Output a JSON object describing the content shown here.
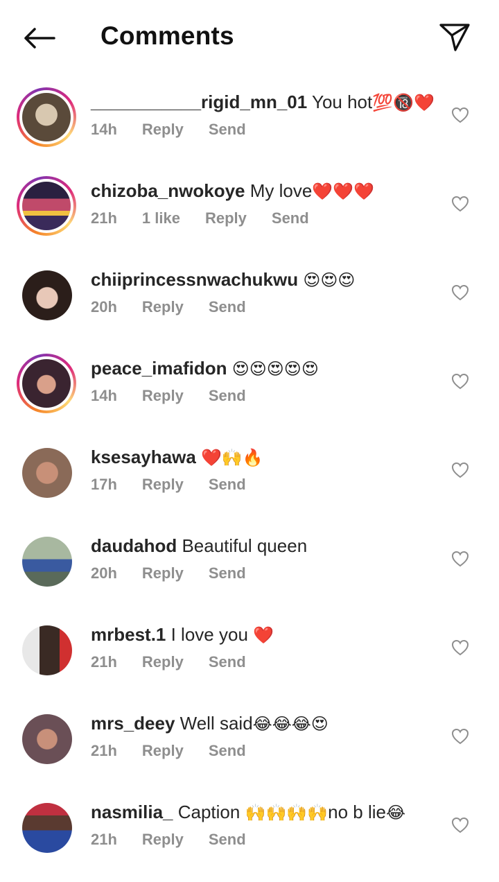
{
  "header": {
    "title": "Comments",
    "back_icon": "arrow-left-icon",
    "share_icon": "paper-plane-icon"
  },
  "comments": [
    {
      "username": "___________rigid_mn_01",
      "text": " You hot",
      "emoji": "💯🔞❤️",
      "time": "14h",
      "likes": "",
      "reply": "Reply",
      "send": "Send",
      "story": true,
      "avatar_bg": "#5a4a3a"
    },
    {
      "username": "chizoba_nwokoye",
      "text": " My love",
      "emoji": "❤️❤️❤️",
      "time": "21h",
      "likes": "1 like",
      "reply": "Reply",
      "send": "Send",
      "story": true,
      "avatar_bg": "#7a3b8a"
    },
    {
      "username": "chiiprincessnwachukwu",
      "text": " ",
      "emoji": "😍😍😍",
      "time": "20h",
      "likes": "",
      "reply": "Reply",
      "send": "Send",
      "story": false,
      "avatar_bg": "#2b1e1a"
    },
    {
      "username": "peace_imafidon",
      "text": " ",
      "emoji": "😍😍😍😍😍",
      "time": "14h",
      "likes": "",
      "reply": "Reply",
      "send": "Send",
      "story": true,
      "avatar_bg": "#3a2430"
    },
    {
      "username": "ksesayhawa",
      "text": " ",
      "emoji": "❤️🙌🔥",
      "time": "17h",
      "likes": "",
      "reply": "Reply",
      "send": "Send",
      "story": false,
      "avatar_bg": "#8a6a58"
    },
    {
      "username": "daudahod",
      "text": " Beautiful queen",
      "emoji": "",
      "time": "20h",
      "likes": "",
      "reply": "Reply",
      "send": "Send",
      "story": false,
      "avatar_bg": "#6b7a6a"
    },
    {
      "username": "mrbest.1",
      "text": " I love you ",
      "emoji": "❤️",
      "time": "21h",
      "likes": "",
      "reply": "Reply",
      "send": "Send",
      "story": false,
      "avatar_bg": "#3a2a24"
    },
    {
      "username": "mrs_deey",
      "text": " Well said",
      "emoji": "😂😂😂😍",
      "time": "21h",
      "likes": "",
      "reply": "Reply",
      "send": "Send",
      "story": false,
      "avatar_bg": "#6a4f56"
    },
    {
      "username": "nasmilia_",
      "text": " Caption ",
      "emoji": "🙌🙌🙌🙌",
      "text2": "no b lie",
      "emoji2": "😂",
      "time": "21h",
      "likes": "",
      "reply": "Reply",
      "send": "Send",
      "story": false,
      "avatar_bg": "#2a3a6a"
    }
  ],
  "like_icon": "heart-outline-icon"
}
